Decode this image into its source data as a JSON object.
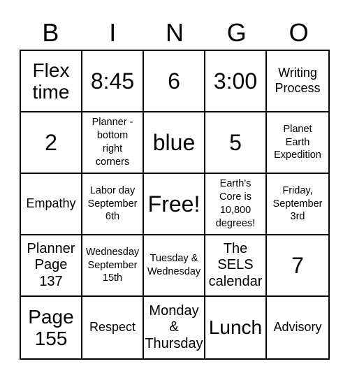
{
  "header": {
    "letters": [
      "B",
      "I",
      "N",
      "G",
      "O"
    ]
  },
  "cells": [
    {
      "text": "Flex\ntime",
      "size": "lg"
    },
    {
      "text": "8:45",
      "size": "xl"
    },
    {
      "text": "6",
      "size": "xl"
    },
    {
      "text": "3:00",
      "size": "xl"
    },
    {
      "text": "Writing\nProcess",
      "size": "sm"
    },
    {
      "text": "2",
      "size": "xl"
    },
    {
      "text": "Planner -\nbottom\nright\ncorners",
      "size": "xs"
    },
    {
      "text": "blue",
      "size": "xl"
    },
    {
      "text": "5",
      "size": "xl"
    },
    {
      "text": "Planet\nEarth\nExpedition",
      "size": "xs"
    },
    {
      "text": "Empathy",
      "size": "sm"
    },
    {
      "text": "Labor day\nSeptember\n6th",
      "size": "xs"
    },
    {
      "text": "Free!",
      "size": "xl"
    },
    {
      "text": "Earth's\nCore is\n10,800\ndegrees!",
      "size": "xs"
    },
    {
      "text": "Friday,\nSeptember\n3rd",
      "size": "xs"
    },
    {
      "text": "Planner\nPage\n137",
      "size": "md"
    },
    {
      "text": "Wednesday\nSeptember\n15th",
      "size": "xs"
    },
    {
      "text": "Tuesday &\nWednesday",
      "size": "xs"
    },
    {
      "text": "The\nSELS\ncalendar",
      "size": "md"
    },
    {
      "text": "7",
      "size": "xl"
    },
    {
      "text": "Page\n155",
      "size": "lg"
    },
    {
      "text": "Respect",
      "size": "sm"
    },
    {
      "text": "Monday\n&\nThursday",
      "size": "md"
    },
    {
      "text": "Lunch",
      "size": "lg"
    },
    {
      "text": "Advisory",
      "size": "sm"
    }
  ]
}
